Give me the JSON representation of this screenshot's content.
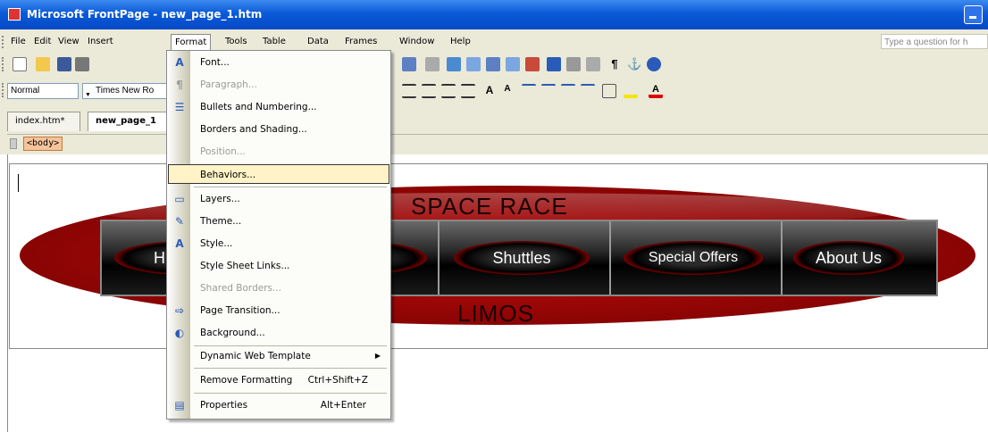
{
  "window": {
    "title": "Microsoft FrontPage - new_page_1.htm"
  },
  "menubar": {
    "items": [
      {
        "label": "File",
        "x": 0
      },
      {
        "label": "Edit"
      },
      {
        "label": "View"
      },
      {
        "label": "Insert"
      },
      {
        "label": "Format"
      },
      {
        "label": "Tools"
      },
      {
        "label": "Table"
      },
      {
        "label": "Data"
      },
      {
        "label": "Frames"
      },
      {
        "label": "Window"
      },
      {
        "label": "Help"
      }
    ],
    "ask_placeholder": "Type a question for h"
  },
  "formatting": {
    "style_value": "Normal",
    "font_value": "Times New Ro"
  },
  "tabs": [
    {
      "label": "index.htm*"
    },
    {
      "label": "new_page_1"
    }
  ],
  "tag_selector": {
    "tag": "<body>"
  },
  "page": {
    "heading_top": "SPACE RACE",
    "heading_bottom": "LIMOS",
    "nav_buttons": [
      {
        "label": "H"
      },
      {
        "label": ""
      },
      {
        "label": "Shuttles"
      },
      {
        "label": "Special Offers"
      },
      {
        "label": "About Us"
      }
    ]
  },
  "format_menu": {
    "items": [
      {
        "label": "Font...",
        "icon": "A",
        "disabled": false
      },
      {
        "label": "Paragraph...",
        "icon": "¶",
        "disabled": true
      },
      {
        "label": "Bullets and Numbering...",
        "icon": "☰",
        "disabled": false
      },
      {
        "label": "Borders and Shading...",
        "icon": "",
        "disabled": false
      },
      {
        "label": "Position...",
        "icon": "",
        "disabled": true
      },
      {
        "label": "Behaviors...",
        "icon": "",
        "disabled": false,
        "highlighted": true
      },
      {
        "label": "Layers...",
        "icon": "▭",
        "disabled": false
      },
      {
        "label": "Theme...",
        "icon": "✎",
        "disabled": false
      },
      {
        "label": "Style...",
        "icon": "A",
        "disabled": false
      },
      {
        "label": "Style Sheet Links...",
        "icon": "",
        "disabled": false
      },
      {
        "label": "Shared Borders...",
        "icon": "",
        "disabled": true
      },
      {
        "label": "Page Transition...",
        "icon": "⇨",
        "disabled": false
      },
      {
        "label": "Background...",
        "icon": "◐",
        "disabled": false
      },
      {
        "label": "Dynamic Web Template",
        "icon": "",
        "disabled": false,
        "submenu": true
      },
      {
        "label": "Remove Formatting",
        "icon": "",
        "shortcut": "Ctrl+Shift+Z",
        "disabled": false
      },
      {
        "label": "Properties",
        "icon": "▤",
        "shortcut": "Alt+Enter",
        "disabled": false
      }
    ]
  },
  "colors": {
    "titlebar": "#0a5ad8",
    "highlight": "#fff3c7",
    "banner_red": "#c10c0c"
  }
}
